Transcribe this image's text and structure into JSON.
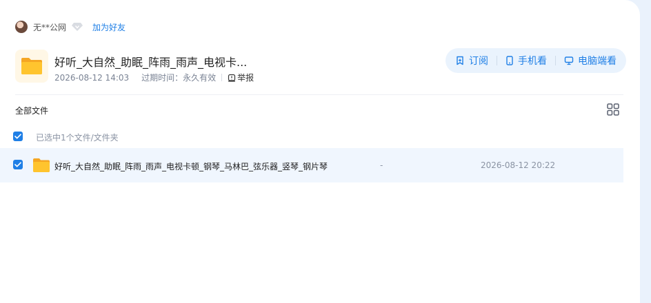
{
  "sharer": {
    "name": "无**公网",
    "add_friend": "加为好友"
  },
  "share": {
    "title": "好听_大自然_助眠_阵雨_雨声_电视卡...",
    "date": "2026-08-12 14:03",
    "expire": "过期时间：永久有效",
    "report": "举报"
  },
  "actions": {
    "subscribe": "订阅",
    "phone": "手机看",
    "pc": "电脑端看"
  },
  "list": {
    "heading": "全部文件",
    "selected_text": "已选中1个文件/文件夹",
    "rows": [
      {
        "name": "好听_大自然_助眠_阵雨_雨声_电视卡顿_钢琴_马林巴_弦乐器_竖琴_钢片琴",
        "size": "-",
        "date": "2026-08-12 20:22"
      }
    ]
  },
  "colors": {
    "accent": "#1f7fe6",
    "folder": "#ffc42e",
    "row_selected": "#f0f6fe",
    "page_bg": "#eaf2fc"
  }
}
